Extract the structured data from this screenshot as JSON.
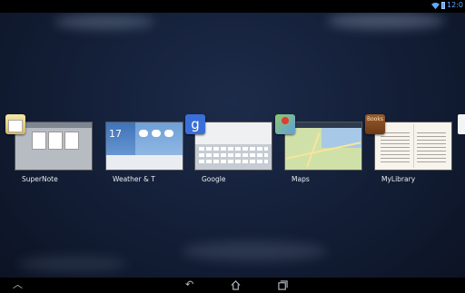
{
  "status_bar": {
    "time": "12:0"
  },
  "recent_apps": [
    {
      "label": "SuperNote",
      "icon": "supernote-icon"
    },
    {
      "label": "Weather & T",
      "icon": "weather-icon",
      "thumb_date": "17"
    },
    {
      "label": "Google",
      "icon": "google-icon",
      "icon_letter": "g"
    },
    {
      "label": "Maps",
      "icon": "maps-icon"
    },
    {
      "label": "MyLibrary",
      "icon": "mylibrary-icon",
      "icon_text": "Books"
    }
  ],
  "nav_bar": {
    "up_icon": "up-arrow-icon",
    "back_icon": "back-icon",
    "home_icon": "home-icon",
    "recents_icon": "recent-apps-icon"
  },
  "colors": {
    "accent": "#5fa8ff",
    "google_blue": "#3a6fd8"
  }
}
